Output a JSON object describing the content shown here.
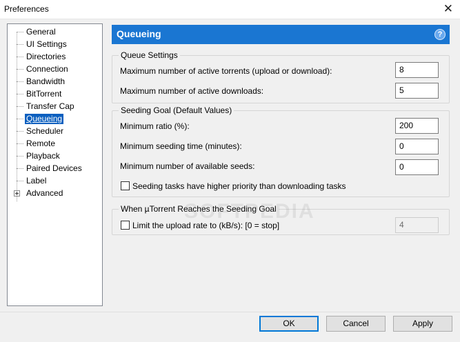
{
  "window": {
    "title": "Preferences",
    "close_glyph": "✕"
  },
  "tree": {
    "items": [
      {
        "label": "General"
      },
      {
        "label": "UI Settings"
      },
      {
        "label": "Directories"
      },
      {
        "label": "Connection"
      },
      {
        "label": "Bandwidth"
      },
      {
        "label": "BitTorrent"
      },
      {
        "label": "Transfer Cap"
      },
      {
        "label": "Queueing",
        "selected": true
      },
      {
        "label": "Scheduler"
      },
      {
        "label": "Remote"
      },
      {
        "label": "Playback"
      },
      {
        "label": "Paired Devices"
      },
      {
        "label": "Label"
      },
      {
        "label": "Advanced",
        "expandable": true
      }
    ]
  },
  "panel": {
    "title": "Queueing",
    "help_icon": "?",
    "header_color": "#1a76d2"
  },
  "queue_settings": {
    "title": "Queue Settings",
    "max_active_torrents_label": "Maximum number of active torrents (upload or download):",
    "max_active_torrents_value": "8",
    "max_active_downloads_label": "Maximum number of active downloads:",
    "max_active_downloads_value": "5"
  },
  "seeding_goal": {
    "title": "Seeding Goal (Default Values)",
    "min_ratio_label": "Minimum ratio (%):",
    "min_ratio_value": "200",
    "min_seed_time_label": "Minimum seeding time (minutes):",
    "min_seed_time_value": "0",
    "min_seeds_label": "Minimum number of available seeds:",
    "min_seeds_value": "0",
    "priority_checkbox_label": "Seeding tasks have higher priority than downloading tasks",
    "priority_checked": false
  },
  "reach_goal": {
    "title": "When µTorrent Reaches the Seeding Goal",
    "limit_checkbox_label": "Limit the upload rate to (kB/s): [0 = stop]",
    "limit_checked": false,
    "limit_value": "4"
  },
  "buttons": {
    "ok": "OK",
    "cancel": "Cancel",
    "apply": "Apply"
  },
  "watermark": "SOFTPEDIA"
}
